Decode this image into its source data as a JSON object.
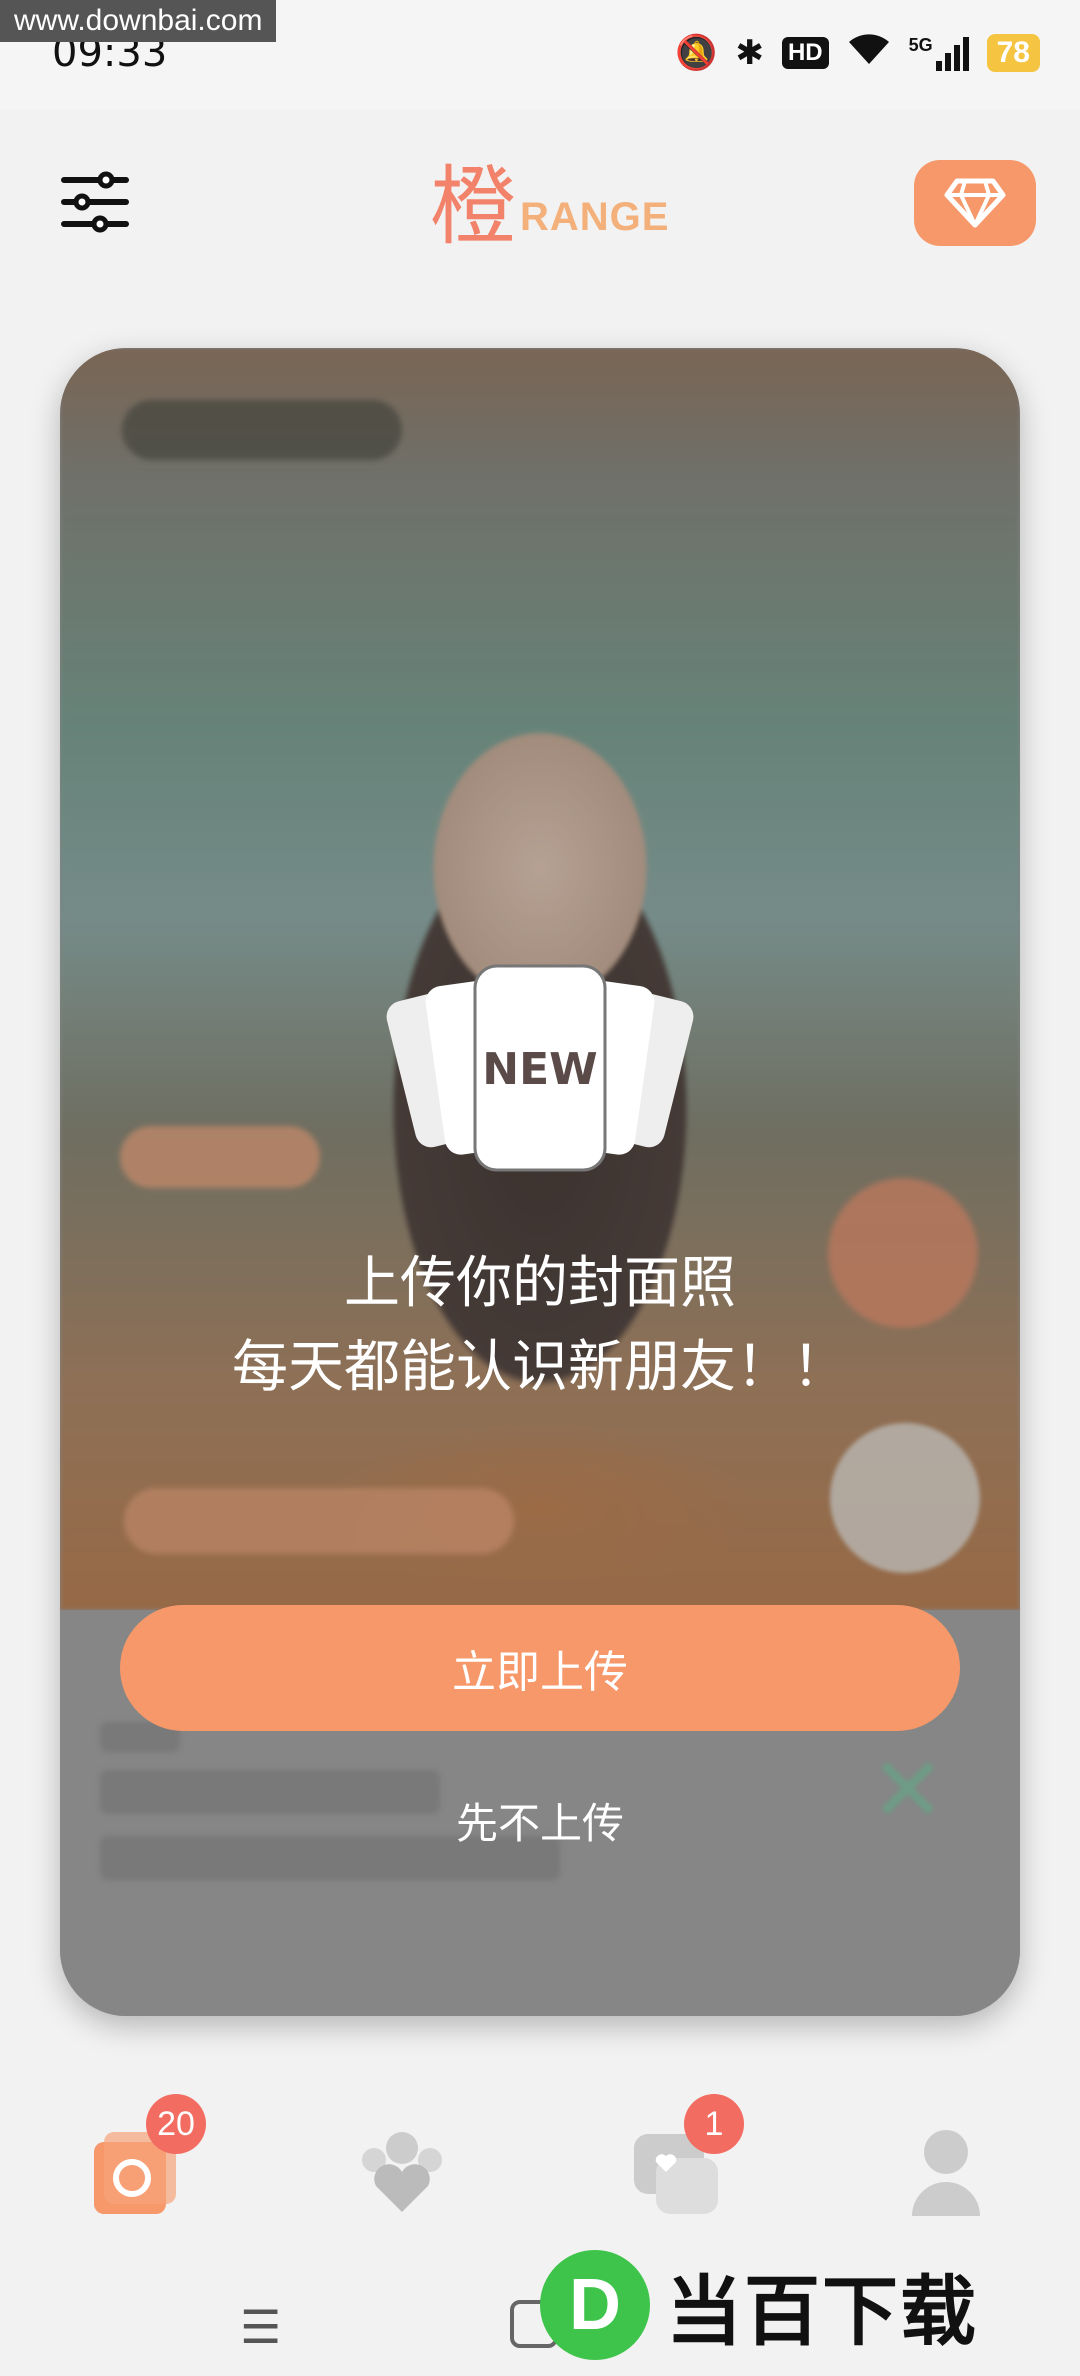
{
  "watermark": "www.downbai.com",
  "status_bar": {
    "time": "09:33",
    "network": "5G",
    "hd_label": "HD",
    "battery": "78"
  },
  "header": {
    "logo_cn": "橙",
    "logo_en": "RANGE"
  },
  "card": {
    "new_badge": "NEW",
    "message_line1": "上传你的封面照",
    "message_line2": "每天都能认识新朋友！！",
    "upload_button": "立即上传",
    "skip_button": "先不上传"
  },
  "bottom_nav": {
    "items": [
      {
        "name": "cards",
        "badge": "20",
        "active": true
      },
      {
        "name": "matches",
        "badge": "",
        "active": false
      },
      {
        "name": "messages",
        "badge": "1",
        "active": false
      },
      {
        "name": "profile",
        "badge": "",
        "active": false
      }
    ]
  },
  "banner": {
    "letter": "D",
    "text": "当百下载"
  },
  "colors": {
    "accent": "#f7986a",
    "badge": "#f26c62",
    "logo": "#f2826a"
  }
}
